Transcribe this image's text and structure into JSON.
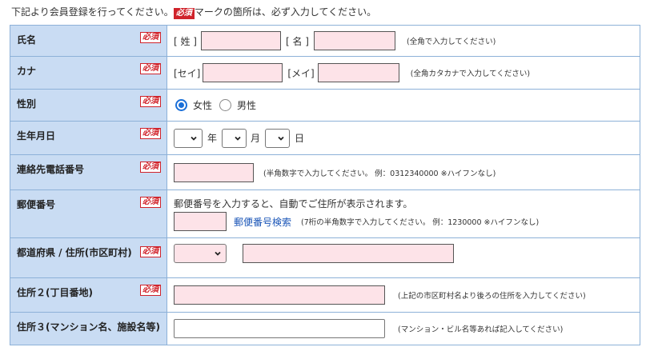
{
  "intro": {
    "before": "下記より会員登録を行ってください。",
    "badge": "必須",
    "after": "マークの箇所は、必ず入力してください。"
  },
  "required_badge": "必須",
  "colors": {
    "label_bg": "#c9dcf3",
    "required_input_bg": "#fde3e8",
    "badge_red": "#d0232b",
    "link_blue": "#1a55b7"
  },
  "rows": {
    "name": {
      "label": "氏名",
      "sei_label": "[ 姓 ]",
      "mei_label": "[ 名 ]",
      "note": "(全角で入力してください)",
      "sei_value": "",
      "mei_value": ""
    },
    "kana": {
      "label": "カナ",
      "sei_label": "[セイ]",
      "mei_label": "[メイ]",
      "note": "(全角カタカナで入力してください)",
      "sei_value": "",
      "mei_value": ""
    },
    "gender": {
      "label": "性別",
      "option_female": "女性",
      "option_male": "男性",
      "selected": "女性"
    },
    "birth": {
      "label": "生年月日",
      "year_unit": "年",
      "month_unit": "月",
      "day_unit": "日",
      "year_value": "",
      "month_value": "",
      "day_value": ""
    },
    "phone": {
      "label": "連絡先電話番号",
      "note": "(半角数字で入力してください。 例：0312340000 ※ハイフンなし)",
      "value": ""
    },
    "postal": {
      "label": "郵便番号",
      "help": "郵便番号を入力すると、自動でご住所が表示されます。",
      "search_link": "郵便番号検索",
      "note": "(7桁の半角数字で入力してください。 例：1230000 ※ハイフンなし)",
      "value": ""
    },
    "prefecture": {
      "label": "都道府県 / 住所(市区町村)",
      "pref_value": "",
      "city_value": ""
    },
    "address2": {
      "label": "住所２(丁目番地)",
      "note": "(上記の市区町村名より後ろの住所を入力してください)",
      "value": ""
    },
    "address3": {
      "label": "住所３(マンション名、施設名等)",
      "note": "(マンション・ビル名等あれば記入してください)",
      "value": ""
    }
  }
}
